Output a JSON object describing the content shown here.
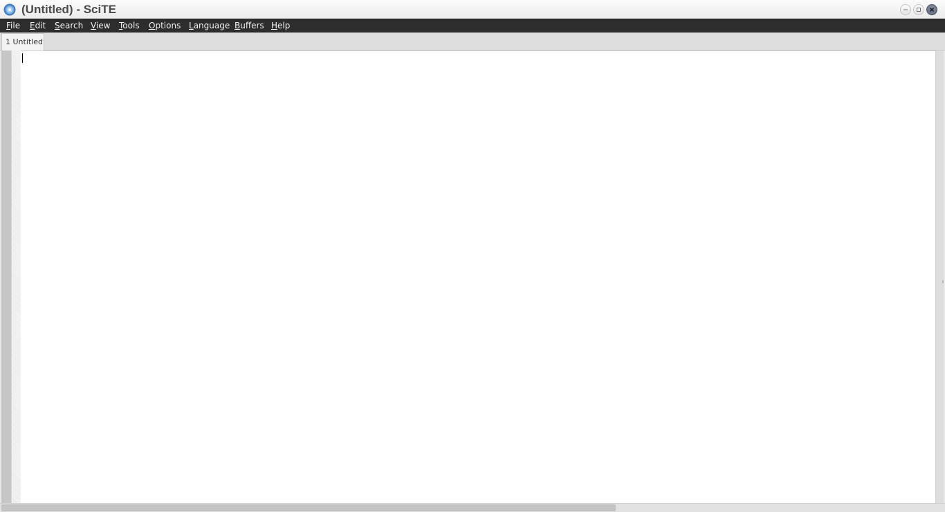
{
  "window": {
    "title": "(Untitled) - SciTE",
    "icon": "scite-app-icon",
    "controls": {
      "minimize_icon": "minimize-icon",
      "maximize_icon": "maximize-icon",
      "close_icon": "close-icon"
    }
  },
  "menubar": {
    "items": [
      {
        "accel": "F",
        "rest": "ile"
      },
      {
        "accel": "E",
        "rest": "dit"
      },
      {
        "accel": "S",
        "rest": "earch"
      },
      {
        "accel": "V",
        "rest": "iew"
      },
      {
        "accel": "T",
        "rest": "ools"
      },
      {
        "accel": "O",
        "rest": "ptions"
      },
      {
        "accel": "L",
        "rest": "anguage"
      },
      {
        "accel": "B",
        "rest": "uffers"
      },
      {
        "accel": "H",
        "rest": "elp"
      }
    ]
  },
  "tabs": [
    {
      "label": "1 Untitled",
      "active": true
    }
  ],
  "editor": {
    "content": ""
  },
  "colors": {
    "menubar_bg": "#2d2d2d",
    "menubar_text": "#f2f2f2",
    "title_text": "#4a4a4a",
    "editor_bg": "#ffffff"
  }
}
